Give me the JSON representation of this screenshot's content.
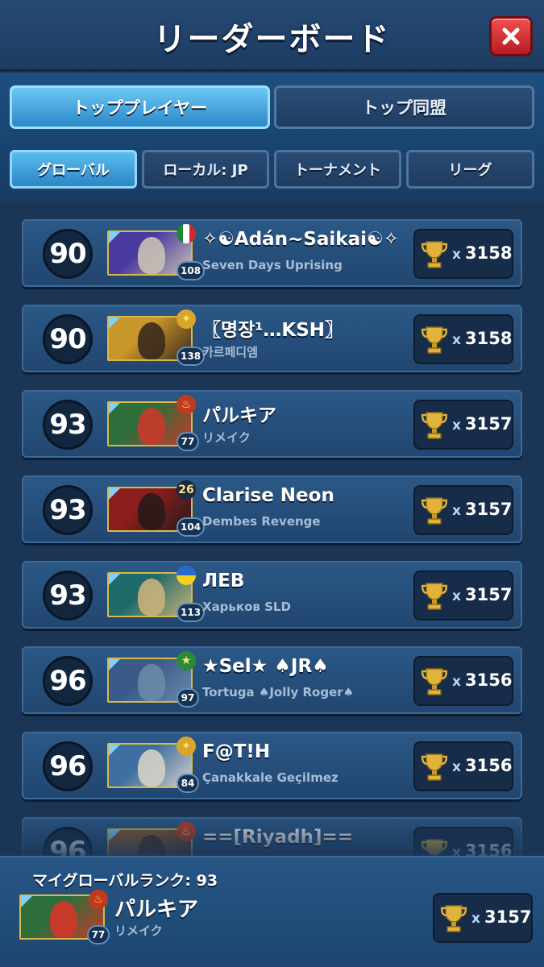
{
  "header": {
    "title": "リーダーボード"
  },
  "main_tabs": [
    {
      "label": "トッププレイヤー",
      "active": true
    },
    {
      "label": "トップ同盟",
      "active": false
    }
  ],
  "sub_tabs": [
    {
      "label": "グローバル",
      "active": true
    },
    {
      "label": "ローカル: JP",
      "active": false
    },
    {
      "label": "トーナメント",
      "active": false
    },
    {
      "label": "リーグ",
      "active": false
    }
  ],
  "rows": [
    {
      "rank": "90",
      "name": "✧☯Adán~Saikai☯✧",
      "alliance": "Seven Days Uprising",
      "level": "108",
      "trophy_prefix": "x",
      "trophies": "3158",
      "emblem": "mexico-flag-icon",
      "portrait_colors": [
        "#4a3aa0",
        "#c9c1b4"
      ]
    },
    {
      "rank": "90",
      "name": "〖명장¹…KSH〗",
      "alliance": "카르페디엠",
      "level": "138",
      "trophy_prefix": "x",
      "trophies": "3158",
      "emblem": "gold-medal-icon",
      "portrait_colors": [
        "#c9962b",
        "#3b2a1c"
      ]
    },
    {
      "rank": "93",
      "name": "パルキア",
      "alliance": "リメイク",
      "level": "77",
      "trophy_prefix": "x",
      "trophies": "3157",
      "emblem": "red-flame-icon",
      "portrait_colors": [
        "#2e6e3a",
        "#c63a2a"
      ]
    },
    {
      "rank": "93",
      "name": "Clarise Neon",
      "alliance": "Dembes Revenge",
      "level": "104",
      "trophy_prefix": "x",
      "trophies": "3157",
      "emblem": "year-2026-icon",
      "portrait_colors": [
        "#8a1d1d",
        "#2a1a1a"
      ]
    },
    {
      "rank": "93",
      "name": "ЛЕВ",
      "alliance": "Харьков SLD",
      "level": "113",
      "trophy_prefix": "x",
      "trophies": "3157",
      "emblem": "ukraine-flag-icon",
      "portrait_colors": [
        "#1f6a6a",
        "#c9b27a"
      ]
    },
    {
      "rank": "96",
      "name": "★Sel★ ♠JR♠",
      "alliance": "Tortuga ♠Jolly Roger♠",
      "level": "97",
      "trophy_prefix": "x",
      "trophies": "3156",
      "emblem": "green-star-icon",
      "portrait_colors": [
        "#3a5a8a",
        "#6a8aa8"
      ]
    },
    {
      "rank": "96",
      "name": "F@T!H",
      "alliance": "Çanakkale Geçilmez",
      "level": "84",
      "trophy_prefix": "x",
      "trophies": "3156",
      "emblem": "gold-medal-icon",
      "portrait_colors": [
        "#3e6fa0",
        "#d3d0c8"
      ]
    },
    {
      "rank": "96",
      "name": "==[Riyadh]==",
      "alliance": "",
      "level": "",
      "trophy_prefix": "x",
      "trophies": "3156",
      "emblem": "red-flame-icon",
      "portrait_colors": [
        "#8a5a2a",
        "#4a2a1a"
      ]
    }
  ],
  "my_rank": {
    "label": "マイグローバルランク: 93",
    "name": "パルキア",
    "alliance": "リメイク",
    "level": "77",
    "trophy_prefix": "x",
    "trophies": "3157",
    "emblem": "red-flame-icon",
    "portrait_colors": [
      "#2e6e3a",
      "#c63a2a"
    ]
  },
  "colors": {
    "gold": "#e0b43a",
    "accent_blue": "#3aa3e0",
    "close_red": "#d8323a"
  }
}
